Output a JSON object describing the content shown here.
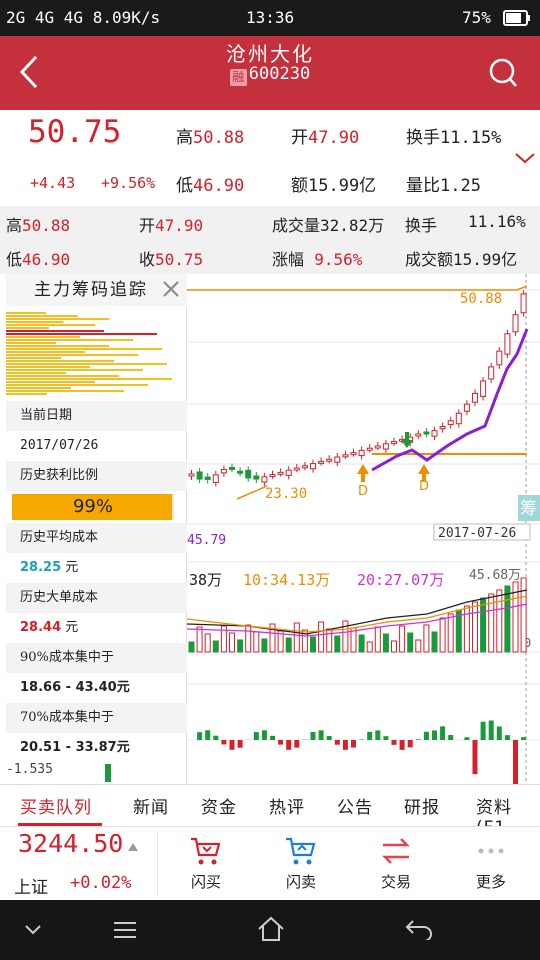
{
  "status_bar": {
    "left": "2G 4G 4G 8.09K/s",
    "time": "13:36",
    "battery": "75%"
  },
  "header": {
    "name": "沧州大化",
    "code": "600230",
    "code_badge": "融"
  },
  "quote": {
    "price": "50.75",
    "change": "+4.43",
    "change_pct": "+9.56%",
    "high_label": "高",
    "high": "50.88",
    "open_label": "开",
    "open": "47.90",
    "turnover_label": "换手",
    "turnover": "11.15%",
    "low_label": "低",
    "low": "46.90",
    "amount_label": "额",
    "amount": "15.99亿",
    "vol_ratio_label": "量比",
    "vol_ratio": "1.25"
  },
  "info_bar": {
    "high_label": "高",
    "high": "50.88",
    "open_label": "开",
    "open": "47.90",
    "volume_label": "成交量",
    "volume": "32.82万",
    "turnover_label": "换手",
    "turnover": "11.16%",
    "low_label": "低",
    "low": "46.90",
    "close_label": "收",
    "close": "50.75",
    "change_label": "涨幅",
    "change": "9.56%",
    "amount_label": "成交额",
    "amount": "15.99亿"
  },
  "chip_panel": {
    "title": "主力筹码追踪",
    "date_label": "当前日期",
    "date": "2017/07/26",
    "profit_label": "历史获利比例",
    "profit": "99%",
    "profit_fraction": 0.99,
    "avg_cost_label": "历史平均成本",
    "avg_cost": "28.25",
    "big_cost_label": "历史大单成本",
    "big_cost": "28.44",
    "unit": "元",
    "c90_label": "90%成本集中于",
    "c90": "18.66 - 43.40元",
    "c70_label": "70%成本集中于",
    "c70": "20.51 - 33.87元"
  },
  "chart": {
    "high_tag": "50.88",
    "low_tag": "23.30",
    "left_edge_value": "45.79",
    "date_tag": "2017-07-26",
    "mark_d": "D",
    "chip_badge": "筹",
    "vol_prefix": "38万",
    "vol_ma10": "10:34.13万",
    "vol_ma20": "20:27.07万",
    "vol_right": "45.68万",
    "vol_zero": "0",
    "macd_low": "-1.535",
    "colors": {
      "up": "#d6202a",
      "down": "#1a9a3a",
      "ma_purple": "#8a1fd6",
      "ma_orange": "#f08c00",
      "ma_black": "#222222",
      "ma_pink": "#d62fd6"
    }
  },
  "tabs": [
    "买卖队列",
    "新闻",
    "资金",
    "热评",
    "公告",
    "研报",
    "资料(F1"
  ],
  "index": {
    "value": "3244.50",
    "name": "上证",
    "change": "+0.02%"
  },
  "toolbar": {
    "flash_buy": "闪买",
    "flash_sell": "闪卖",
    "trade": "交易",
    "more": "更多"
  }
}
